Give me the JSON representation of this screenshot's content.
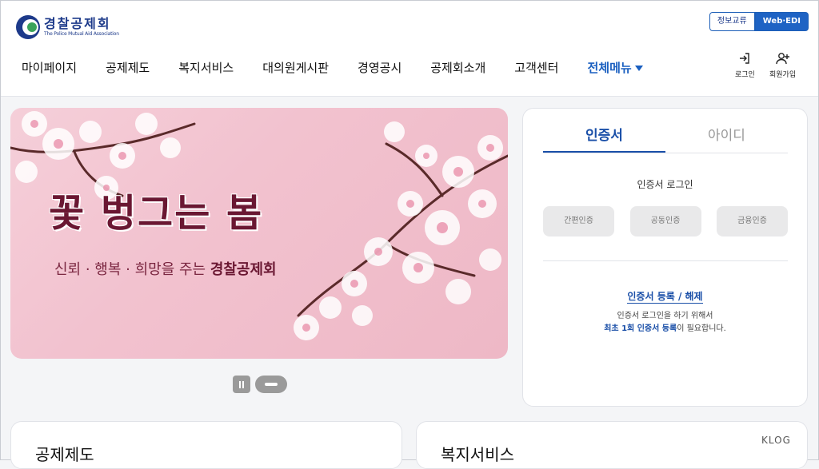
{
  "header": {
    "logo_kor": "경찰공제회",
    "logo_eng": "The Police Mutual Aid Association",
    "top_links": [
      "정보교류",
      "Web·EDI"
    ],
    "gnb": [
      "마이페이지",
      "공제제도",
      "복지서비스",
      "대의원게시판",
      "경영공시",
      "공제회소개",
      "고객센터"
    ],
    "all_menu": "전체메뉴",
    "util": {
      "login": "로그인",
      "signup": "회원가입"
    }
  },
  "banner": {
    "title": "꽃 벙그는 봄",
    "subtitle_prefix": "신뢰 · 행복 · 희망을 주는 ",
    "subtitle_brand": "경찰공제회"
  },
  "login": {
    "tabs": [
      "인증서",
      "아이디"
    ],
    "title": "인증서 로그인",
    "auth_buttons": [
      "간편인증",
      "공동인증",
      "금융인증"
    ],
    "cert_link": "인증서 등록 / 해제",
    "desc_line1": "인증서 로그인을 하기 위해서",
    "desc_line2_hl": "최초 1회 인증서 등록",
    "desc_line2_rest": "이 필요합니다."
  },
  "cards": [
    "공제제도",
    "복지서비스"
  ],
  "watermark": "KLOG",
  "colors": {
    "brand": "#1d3a8a",
    "accent": "#1a4fa8",
    "banner_text": "#6a1732"
  }
}
